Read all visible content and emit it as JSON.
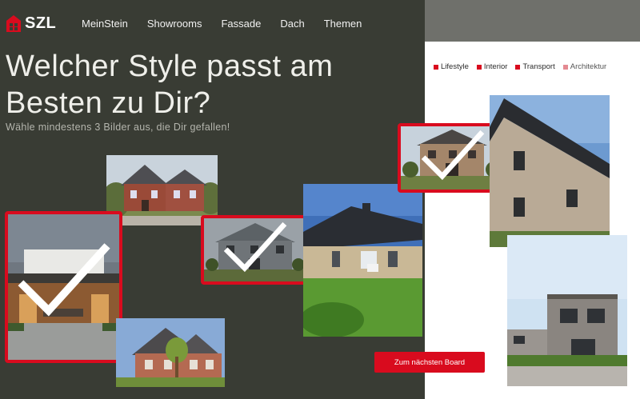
{
  "brand": {
    "logo_text": "SZL"
  },
  "nav": {
    "items": [
      "MeinStein",
      "Showrooms",
      "Fassade",
      "Dach",
      "Themen"
    ]
  },
  "hero": {
    "title": "Welcher Style passt am Besten zu Dir?",
    "subtitle": "Wähle mindestens 3 Bilder aus, die Dir gefallen!"
  },
  "tags": [
    {
      "label": "Lifestyle",
      "color": "#d90b1e"
    },
    {
      "label": "Interior",
      "color": "#d90b1e"
    },
    {
      "label": "Transport",
      "color": "#d90b1e"
    },
    {
      "label": "Architektur",
      "color": "#e48a92"
    }
  ],
  "cta": {
    "label": "Zum nächsten Board"
  },
  "images": [
    {
      "name": "red-brick-villa",
      "selected": false
    },
    {
      "name": "modern-house-night",
      "selected": true
    },
    {
      "name": "gray-villa",
      "selected": true
    },
    {
      "name": "bungalow-dark-roof",
      "selected": false
    },
    {
      "name": "red-brick-cottage",
      "selected": false
    },
    {
      "name": "brown-villa",
      "selected": true
    },
    {
      "name": "gray-brick-gable-house",
      "selected": false
    },
    {
      "name": "modern-cube-house",
      "selected": false
    }
  ],
  "colors": {
    "accent": "#d90b1e",
    "dark_bg": "#393c34",
    "top_right_bar": "#6f706b"
  }
}
